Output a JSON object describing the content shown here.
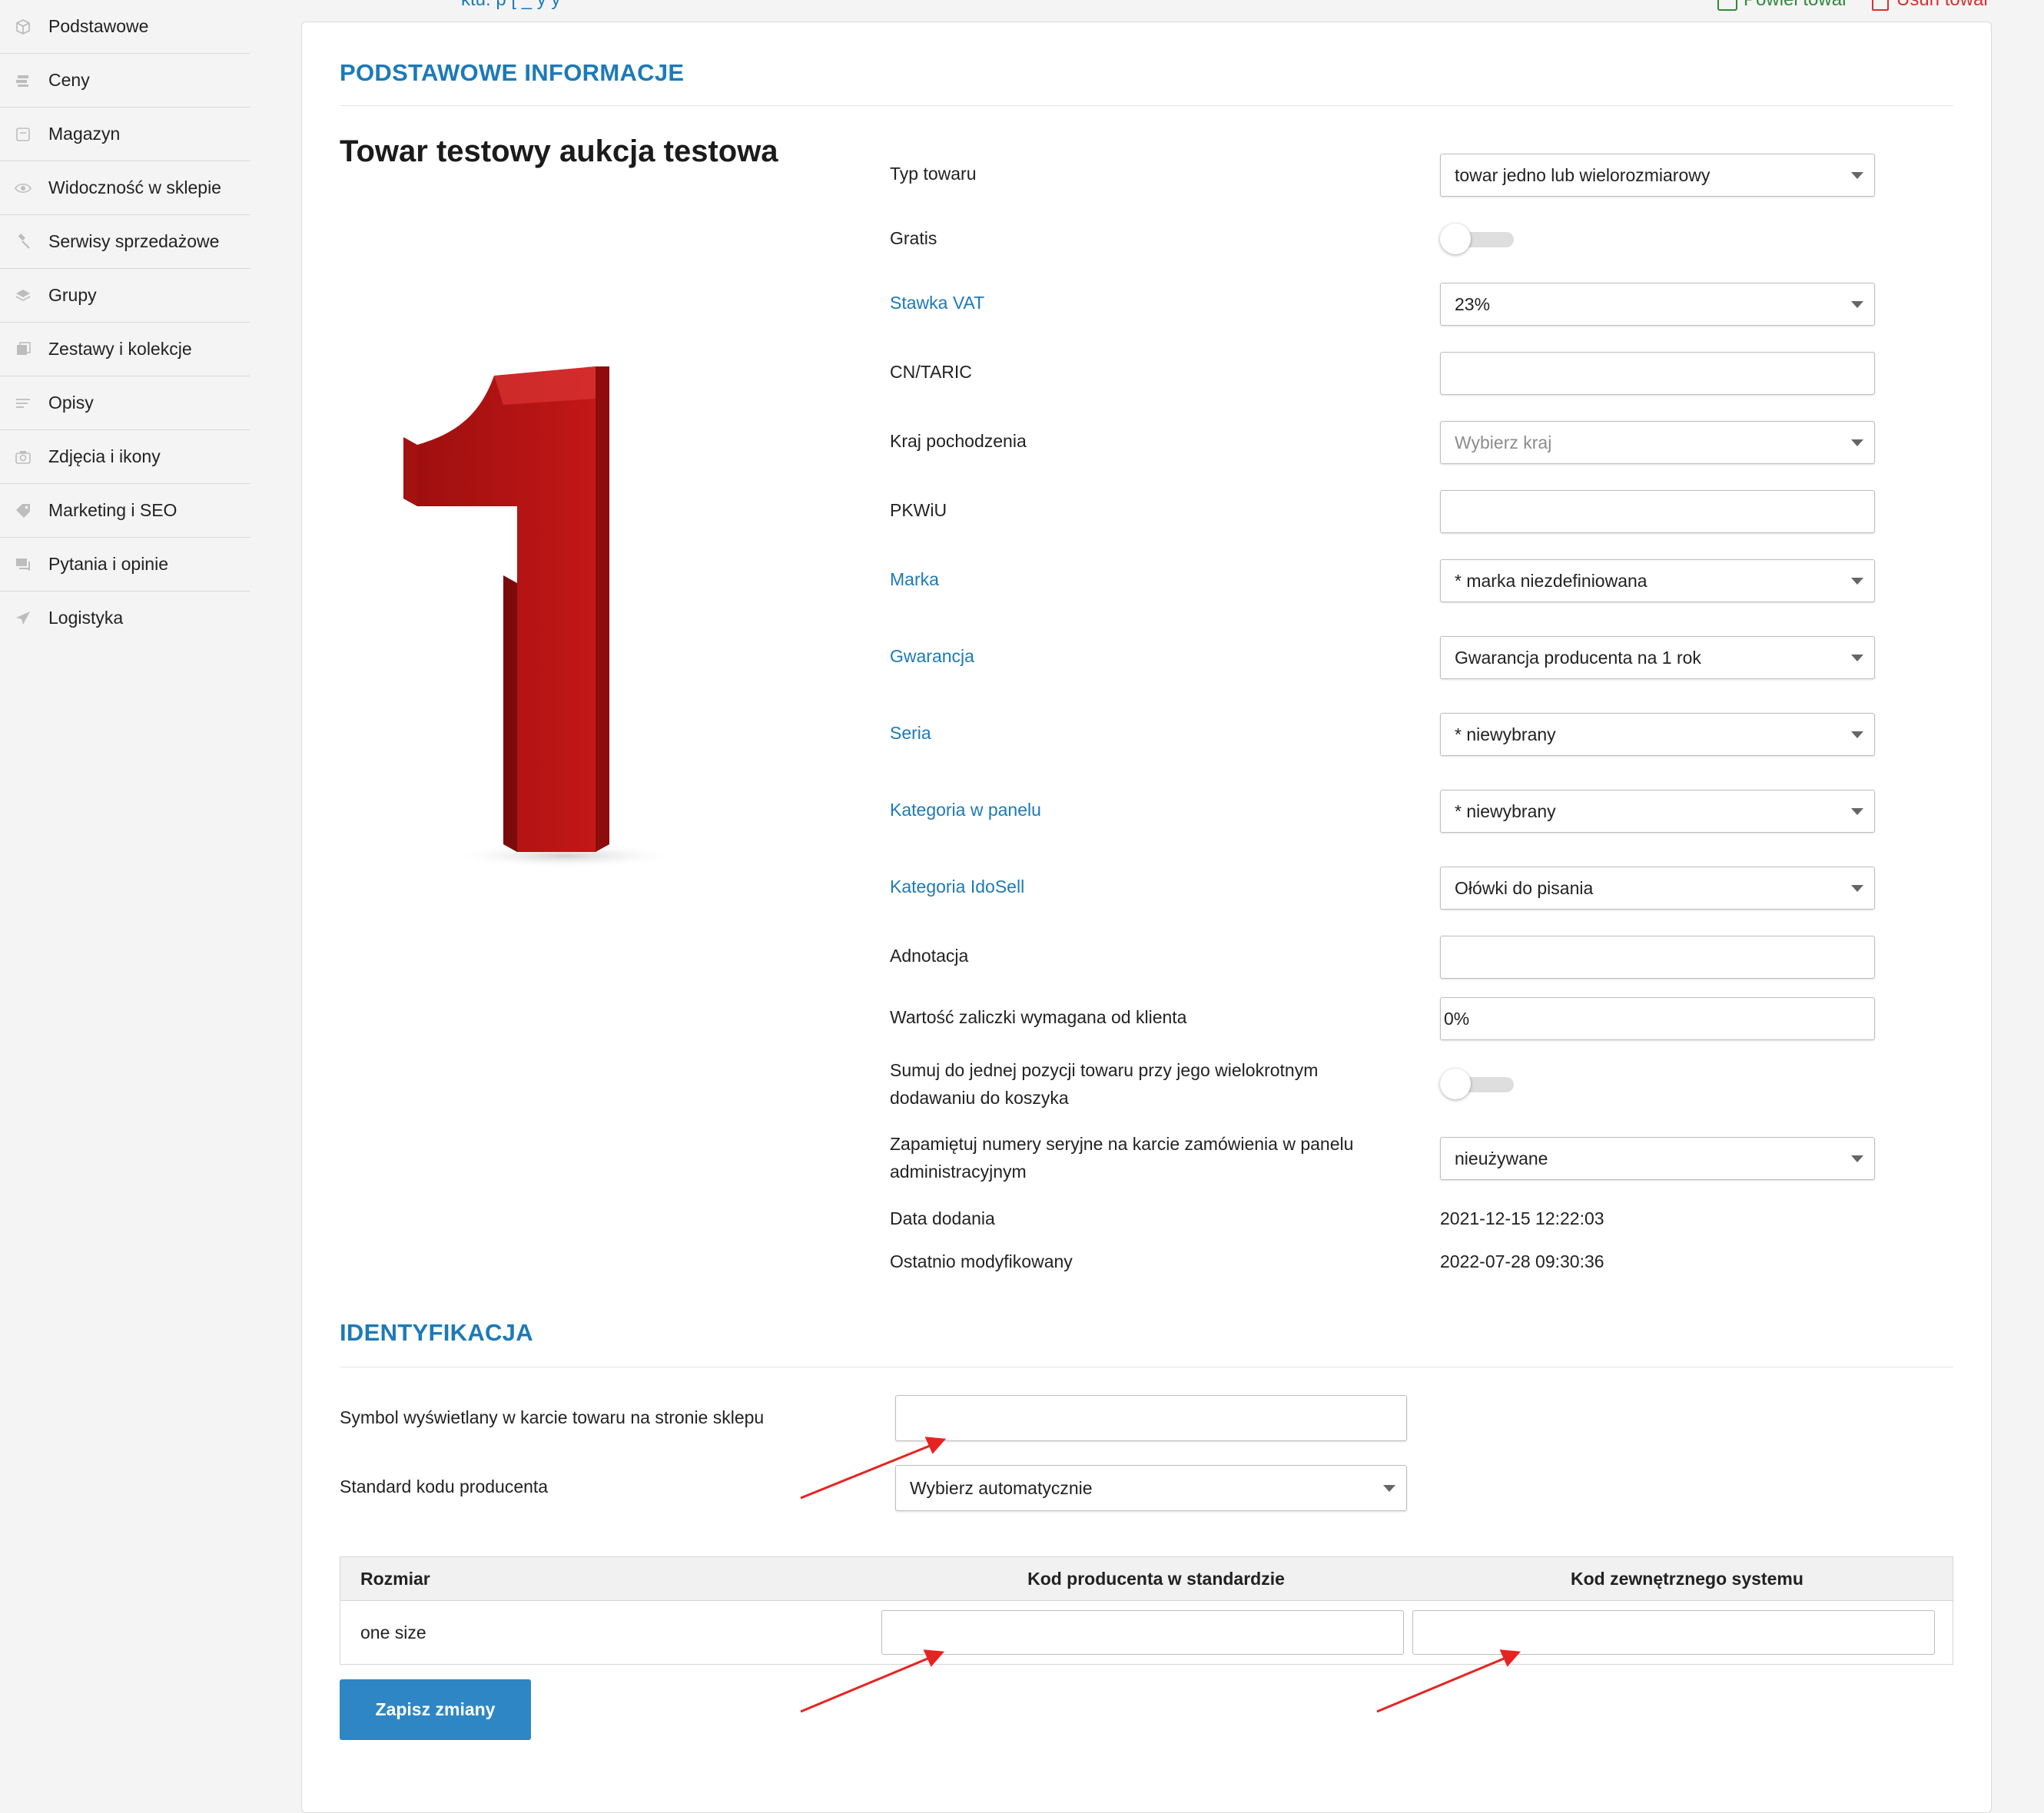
{
  "top_links": {
    "left": "ktu: p [ _ y y",
    "green": "Powiel towar",
    "red": "Usuń towar"
  },
  "sidebar": {
    "items": [
      {
        "label": "Podstawowe",
        "icon": "cube-icon"
      },
      {
        "label": "Ceny",
        "icon": "price-icon"
      },
      {
        "label": "Magazyn",
        "icon": "warehouse-icon"
      },
      {
        "label": "Widoczność w sklepie",
        "icon": "eye-icon"
      },
      {
        "label": "Serwisy sprzedażowe",
        "icon": "gavel-icon"
      },
      {
        "label": "Grupy",
        "icon": "layers-icon"
      },
      {
        "label": "Zestawy i kolekcje",
        "icon": "collection-icon"
      },
      {
        "label": "Opisy",
        "icon": "text-icon"
      },
      {
        "label": "Zdjęcia i ikony",
        "icon": "camera-icon"
      },
      {
        "label": "Marketing i SEO",
        "icon": "tag-icon"
      },
      {
        "label": "Pytania i opinie",
        "icon": "chat-icon"
      },
      {
        "label": "Logistyka",
        "icon": "plane-icon"
      }
    ]
  },
  "basic": {
    "section_title": "PODSTAWOWE INFORMACJE",
    "product_title": "Towar testowy aukcja testowa",
    "image_text": "1",
    "fields": {
      "typ_towaru": {
        "label": "Typ towaru",
        "value": "towar jedno lub wielorozmiarowy"
      },
      "gratis": {
        "label": "Gratis",
        "on": false
      },
      "vat": {
        "label": "Stawka VAT",
        "value": "23%"
      },
      "cn_taric": {
        "label": "CN/TARIC",
        "value": ""
      },
      "kraj": {
        "label": "Kraj pochodzenia",
        "placeholder": "Wybierz kraj"
      },
      "pkwiu": {
        "label": "PKWiU",
        "value": ""
      },
      "marka": {
        "label": "Marka",
        "value": "* marka niezdefiniowana"
      },
      "gwarancja": {
        "label": "Gwarancja",
        "value": "Gwarancja producenta na 1 rok"
      },
      "seria": {
        "label": "Seria",
        "value": "* niewybrany"
      },
      "kategoria_panel": {
        "label": "Kategoria w panelu",
        "value": "* niewybrany"
      },
      "kategoria_idosell": {
        "label": "Kategoria IdoSell",
        "value": "Ołówki do pisania"
      },
      "adnotacja": {
        "label": "Adnotacja",
        "value": ""
      },
      "zaliczka": {
        "label": "Wartość zaliczki wymagana od klienta",
        "value": "0%"
      },
      "sumuj": {
        "label_line1": "Sumuj do jednej pozycji towaru przy jego wielokrotnym",
        "label_line2": "dodawaniu do koszyka",
        "on": false
      },
      "serial": {
        "label_line1": "Zapamiętuj numery seryjne na karcie zamówienia w panelu",
        "label_line2": "administracyjnym",
        "value": "nieużywane"
      },
      "data_dodania": {
        "label": "Data dodania",
        "value": "2021-12-15 12:22:03"
      },
      "modyfikowany": {
        "label": "Ostatnio modyfikowany",
        "value": "2022-07-28 09:30:36"
      }
    }
  },
  "ident": {
    "section_title": "IDENTYFIKACJA",
    "symbol_label": "Symbol wyświetlany w karcie towaru na stronie sklepu",
    "symbol_value": "",
    "standard_label": "Standard kodu producenta",
    "standard_value": "Wybierz automatycznie",
    "table": {
      "headers": [
        "Rozmiar",
        "Kod producenta w standardzie",
        "Kod zewnętrznego systemu"
      ],
      "rows": [
        {
          "size": "one size",
          "producer_code": "",
          "external_code": ""
        }
      ]
    },
    "save_label": "Zapisz zmiany"
  },
  "colors": {
    "accent": "#1c7ab8",
    "button": "#2f86c4",
    "annotation_arrow": "#e52421",
    "green_link": "#2e8b3a",
    "red_link": "#d9302c"
  }
}
